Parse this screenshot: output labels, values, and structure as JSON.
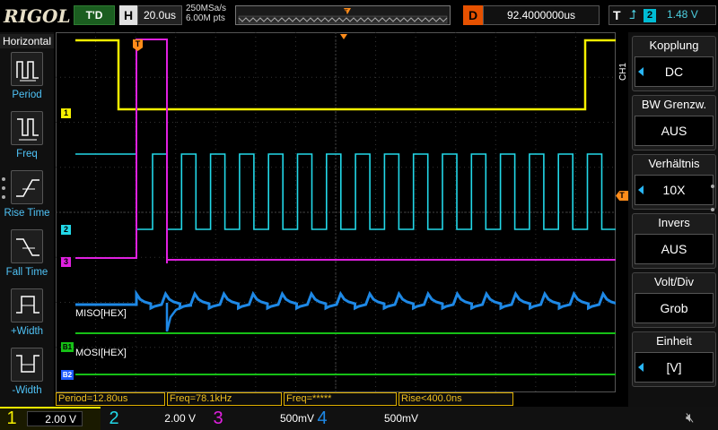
{
  "topbar": {
    "logo": "RIGOL",
    "run_status": "T'D",
    "horizontal_label": "H",
    "timebase": "20.0us",
    "sample_rate": "250MSa/s",
    "memory_depth": "6.00M pts",
    "delay_label": "D",
    "delay_value": "92.4000000us",
    "trigger_label": "T",
    "trigger_source": "2",
    "trigger_level": "1.48 V"
  },
  "left_menu": {
    "title": "Horizontal",
    "items": [
      {
        "label": "Period",
        "icon": "period-icon"
      },
      {
        "label": "Freq",
        "icon": "freq-icon"
      },
      {
        "label": "Rise Time",
        "icon": "rise-time-icon"
      },
      {
        "label": "Fall Time",
        "icon": "fall-time-icon"
      },
      {
        "label": "+Width",
        "icon": "pos-width-icon"
      },
      {
        "label": "-Width",
        "icon": "neg-width-icon"
      }
    ]
  },
  "right_menu": {
    "channel_tag": "CH1",
    "items": [
      {
        "title": "Kopplung",
        "value": "DC"
      },
      {
        "title": "BW Grenzw.",
        "value": "AUS"
      },
      {
        "title": "Verhältnis",
        "value": "10X"
      },
      {
        "title": "Invers",
        "value": "AUS"
      },
      {
        "title": "Volt/Div",
        "value": "Grob"
      },
      {
        "title": "Einheit",
        "value": "[V]"
      }
    ]
  },
  "traces": {
    "ch1_marker": "1",
    "ch2_marker": "2",
    "ch3_marker": "3",
    "bus1_marker": "B1",
    "bus2_marker": "B2",
    "bus1_label": "MISO[HEX]",
    "bus2_label": "MOSI[HEX]",
    "trigger_marker": "T"
  },
  "measurements": [
    {
      "text": "Period=12.80us"
    },
    {
      "text": "Freq=78.1kHz"
    },
    {
      "text": "Freq=*****"
    },
    {
      "text": "Rise<400.0ns"
    }
  ],
  "channels": [
    {
      "num": "1",
      "scale": "2.00 V",
      "color": "#ffee00"
    },
    {
      "num": "2",
      "scale": "2.00 V",
      "color": "#00e5ff"
    },
    {
      "num": "3",
      "scale": "500mV",
      "color": "#e040fb"
    },
    {
      "num": "4",
      "scale": "500mV",
      "color": "#2196f3"
    }
  ],
  "colors": {
    "ch1": "#f5f000",
    "ch2": "#22d8e8",
    "ch3": "#e020e0",
    "ch4": "#1e88e5",
    "bus": "#16c016",
    "trigger": "#ff8c1a"
  }
}
